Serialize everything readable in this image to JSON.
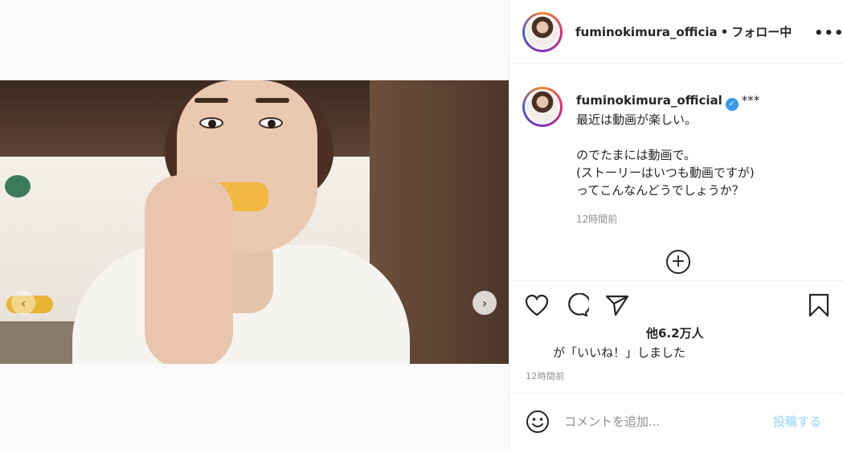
{
  "header": {
    "username": "fuminokimura_officia",
    "separator": "•",
    "follow_status": "フォロー中",
    "more_icon": "more-horizontal-icon"
  },
  "media": {
    "type": "video",
    "slide_count": 2,
    "active_slide": 2,
    "prev_icon": "chevron-left-icon",
    "next_icon": "chevron-right-icon",
    "sound_icon": "speaker-icon"
  },
  "caption": {
    "username": "fuminokimura_official",
    "verified_icon": "verified-badge-icon",
    "stars": "***",
    "lines": [
      "最近は動画が楽しい。",
      "",
      "のでたまには動画で。",
      "(ストーリーはいつも動画ですが)",
      "ってこんなんどうでしょうか？"
    ],
    "time": "12時間前",
    "load_more_icon": "plus-circle-icon"
  },
  "actions": {
    "like_icon": "heart-icon",
    "comment_icon": "comment-icon",
    "share_icon": "send-icon",
    "save_icon": "bookmark-icon"
  },
  "likes": {
    "count": "他6.2万人",
    "text": "が「いいね！」しました"
  },
  "post_time": "12時間前",
  "comment": {
    "emoji_icon": "smiley-icon",
    "placeholder": "コメントを追加...",
    "post_label": "投稿する"
  },
  "colors": {
    "accent_blue": "#3897f0",
    "disabled_blue": "#b2dffc",
    "text_primary": "#262626",
    "text_secondary": "#8e8e8e",
    "border": "#efefef"
  }
}
